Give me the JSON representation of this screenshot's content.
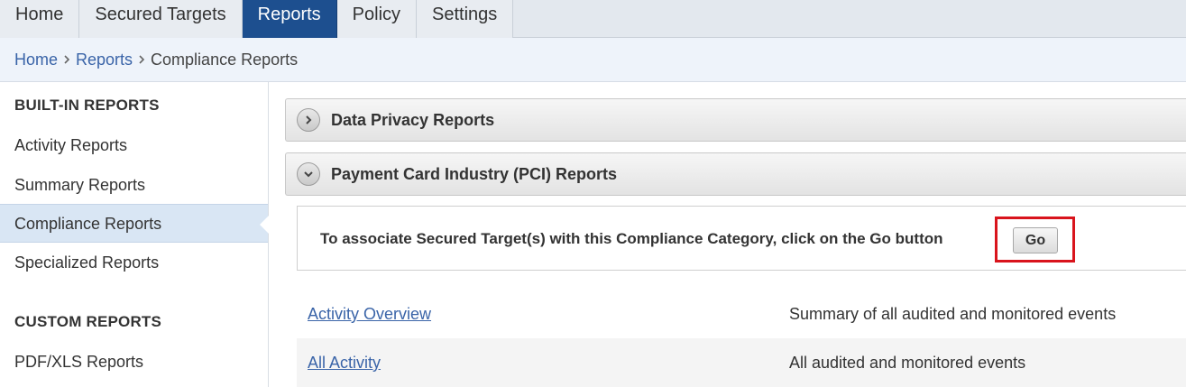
{
  "nav": {
    "tabs": [
      {
        "label": "Home"
      },
      {
        "label": "Secured Targets"
      },
      {
        "label": "Reports"
      },
      {
        "label": "Policy"
      },
      {
        "label": "Settings"
      }
    ],
    "active_tab": "Reports"
  },
  "breadcrumb": {
    "items": [
      "Home",
      "Reports",
      "Compliance Reports"
    ]
  },
  "sidebar": {
    "builtin_title": "BUILT-IN REPORTS",
    "builtin_items": [
      {
        "label": "Activity Reports"
      },
      {
        "label": "Summary Reports"
      },
      {
        "label": "Compliance Reports"
      },
      {
        "label": "Specialized Reports"
      }
    ],
    "custom_title": "CUSTOM REPORTS",
    "custom_items": [
      {
        "label": "PDF/XLS Reports"
      }
    ]
  },
  "main": {
    "panels": [
      {
        "title": "Data Privacy Reports",
        "state": "collapsed",
        "icon": "chevron-right-icon"
      },
      {
        "title": "Payment Card Industry (PCI) Reports",
        "state": "expanded",
        "icon": "chevron-down-icon"
      }
    ],
    "go_message": "To associate Secured Target(s) with this Compliance Category, click on the Go button",
    "go_button_label": "Go",
    "reports": [
      {
        "name": "Activity Overview",
        "description": "Summary of all audited and monitored events"
      },
      {
        "name": "All Activity",
        "description": "All audited and monitored events"
      }
    ]
  },
  "colors": {
    "active_tab": "#1d4f8f",
    "link": "#3a64a8",
    "highlight_box": "#d9141c",
    "sidebar_active": "#d9e6f4"
  }
}
